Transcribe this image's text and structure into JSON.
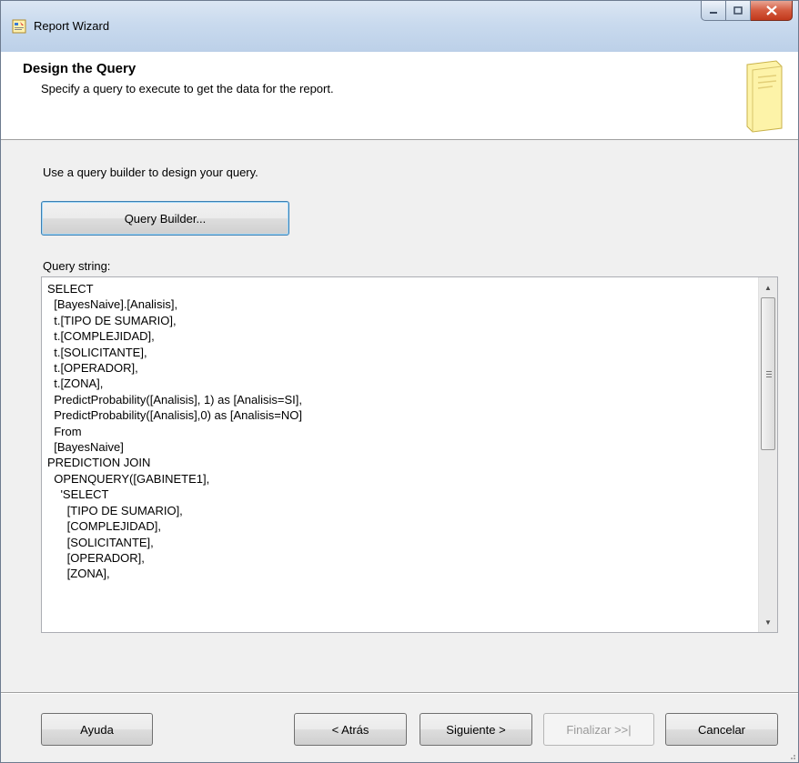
{
  "window": {
    "title": "Report Wizard"
  },
  "header": {
    "title": "Design the Query",
    "subtitle": "Specify a query to execute to get the data for the report."
  },
  "content": {
    "instructions": "Use a query builder to design your query.",
    "query_builder_label": "Query Builder...",
    "query_string_label": "Query string:",
    "query_text": "SELECT\n  [BayesNaive].[Analisis],\n  t.[TIPO DE SUMARIO],\n  t.[COMPLEJIDAD],\n  t.[SOLICITANTE],\n  t.[OPERADOR],\n  t.[ZONA],\n  PredictProbability([Analisis], 1) as [Analisis=SI],\n  PredictProbability([Analisis],0) as [Analisis=NO]\n  From\n  [BayesNaive]\nPREDICTION JOIN\n  OPENQUERY([GABINETE1],\n    'SELECT\n      [TIPO DE SUMARIO],\n      [COMPLEJIDAD],\n      [SOLICITANTE],\n      [OPERADOR],\n      [ZONA],"
  },
  "footer": {
    "help_label": "Ayuda",
    "back_label": "< Atrás",
    "next_label": "Siguiente >",
    "finish_label": "Finalizar >>|",
    "cancel_label": "Cancelar"
  },
  "icons": {
    "app": "report-wizard-icon",
    "header": "document-icon",
    "minimize": "minimize-icon",
    "maximize": "maximize-icon",
    "close": "close-icon",
    "scroll_up": "scroll-up-arrow-icon",
    "scroll_down": "scroll-down-arrow-icon"
  },
  "colors": {
    "titlebar": "#c9daee",
    "close_button": "#c2391c",
    "focus_border": "#3c7fb1"
  }
}
